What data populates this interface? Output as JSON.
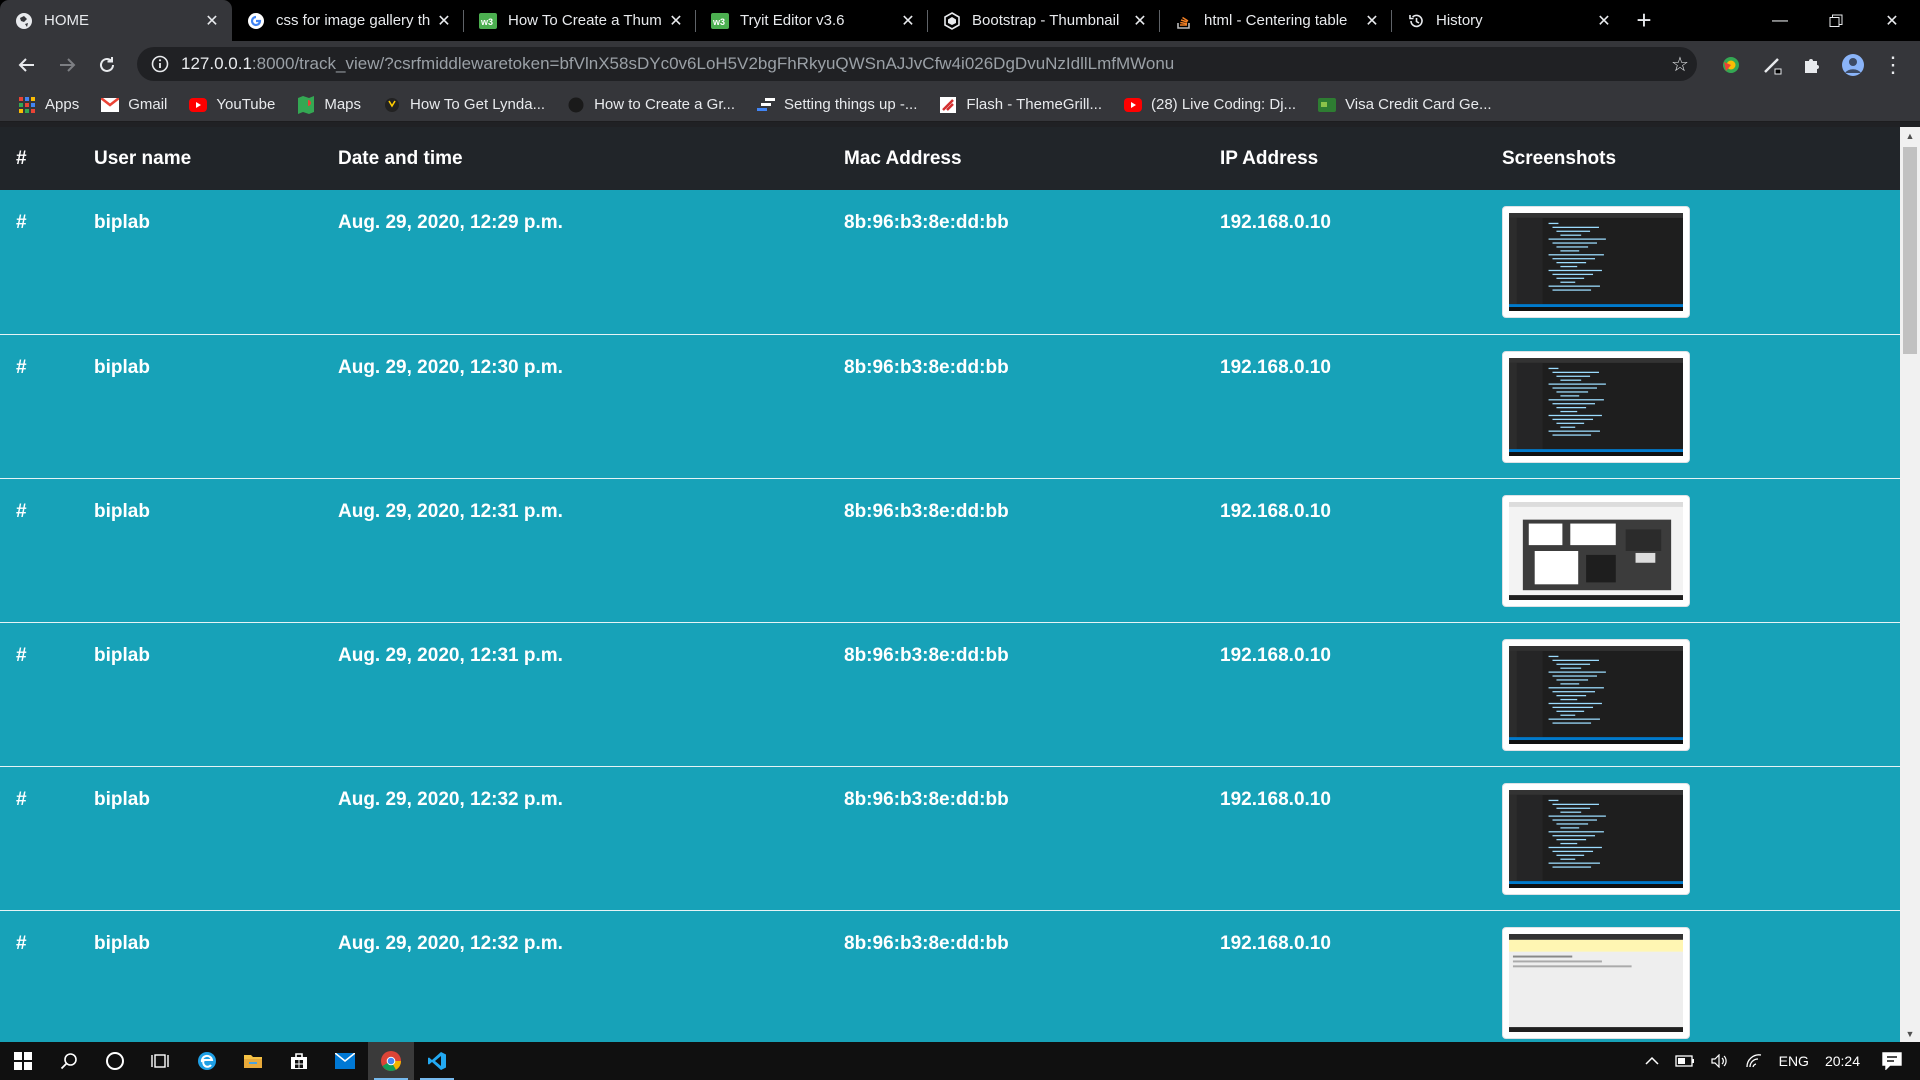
{
  "browser": {
    "tabs": [
      {
        "title": "HOME",
        "icon": "globe-icon",
        "active": true
      },
      {
        "title": "css for image gallery th",
        "icon": "google-icon"
      },
      {
        "title": "How To Create a Thum",
        "icon": "w3schools-icon"
      },
      {
        "title": "Tryit Editor v3.6",
        "icon": "w3schools-icon"
      },
      {
        "title": "Bootstrap - Thumbnail",
        "icon": "bootstrap-icon"
      },
      {
        "title": "html - Centering table",
        "icon": "stackoverflow-icon"
      },
      {
        "title": "History",
        "icon": "history-icon"
      }
    ],
    "url_host": "127.0.0.1",
    "url_rest": ":8000/track_view/?csrfmiddlewaretoken=bfVlnX58sDYc0v6LoH5V2bgFhRkyuQWSnAJJvCfw4i026DgDvuNzIdllLmfMWonu",
    "bookmarks": [
      {
        "label": "Apps",
        "icon": "apps-grid-icon"
      },
      {
        "label": "Gmail",
        "icon": "gmail-icon"
      },
      {
        "label": "YouTube",
        "icon": "youtube-icon"
      },
      {
        "label": "Maps",
        "icon": "maps-icon"
      },
      {
        "label": "How To Get Lynda...",
        "icon": "lynda-icon"
      },
      {
        "label": "How to Create a Gr...",
        "icon": "dark-circle-icon"
      },
      {
        "label": "Setting things up -...",
        "icon": "bars-icon"
      },
      {
        "label": "Flash - ThemeGrill...",
        "icon": "flash-icon"
      },
      {
        "label": "(28) Live Coding: Dj...",
        "icon": "youtube-icon"
      },
      {
        "label": "Visa Credit Card Ge...",
        "icon": "card-icon"
      }
    ]
  },
  "table": {
    "headers": [
      "#",
      "User name",
      "Date and time",
      "Mac Address",
      "IP Address",
      "Screenshots"
    ],
    "rows": [
      {
        "num": "#",
        "user": "biplab",
        "datetime": "Aug. 29, 2020, 12:29 p.m.",
        "mac": "8b:96:b3:8e:dd:bb",
        "ip": "192.168.0.10",
        "shot": "dark-editor"
      },
      {
        "num": "#",
        "user": "biplab",
        "datetime": "Aug. 29, 2020, 12:30 p.m.",
        "mac": "8b:96:b3:8e:dd:bb",
        "ip": "192.168.0.10",
        "shot": "dark-editor"
      },
      {
        "num": "#",
        "user": "biplab",
        "datetime": "Aug. 29, 2020, 12:31 p.m.",
        "mac": "8b:96:b3:8e:dd:bb",
        "ip": "192.168.0.10",
        "shot": "windows"
      },
      {
        "num": "#",
        "user": "biplab",
        "datetime": "Aug. 29, 2020, 12:31 p.m.",
        "mac": "8b:96:b3:8e:dd:bb",
        "ip": "192.168.0.10",
        "shot": "dark-editor"
      },
      {
        "num": "#",
        "user": "biplab",
        "datetime": "Aug. 29, 2020, 12:32 p.m.",
        "mac": "8b:96:b3:8e:dd:bb",
        "ip": "192.168.0.10",
        "shot": "dark-editor"
      },
      {
        "num": "#",
        "user": "biplab",
        "datetime": "Aug. 29, 2020, 12:32 p.m.",
        "mac": "8b:96:b3:8e:dd:bb",
        "ip": "192.168.0.10",
        "shot": "light-page"
      }
    ]
  },
  "taskbar": {
    "language": "ENG",
    "time": "20:24"
  }
}
